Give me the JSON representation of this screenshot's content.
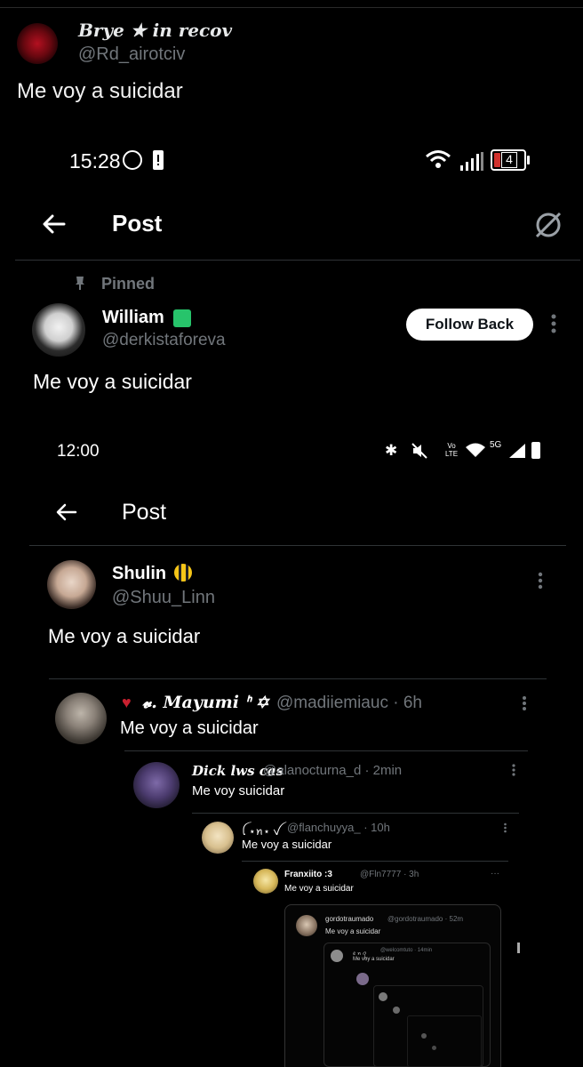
{
  "outer": {
    "author_name": "Brye ★ in recov",
    "author_handle": "@Rd_airotciv",
    "tweet_text": "Me voy a suicidar"
  },
  "screen1": {
    "status_time": "15:28",
    "battery": "4",
    "title": "Post",
    "pinned_label": "Pinned",
    "author_name": "William",
    "author_handle": "@derkistaforeva",
    "follow_label": "Follow Back",
    "tweet_text": "Me voy a suicidar"
  },
  "screen2": {
    "status_time": "12:00",
    "network": "5G",
    "volte": "Vo LTE",
    "title": "Post",
    "author_name": "Shulin",
    "author_handle": "@Shuu_Linn",
    "tweet_text": "Me voy a suicidar"
  },
  "reply1": {
    "name": "𝓿. Mayumi ᑋ ✡",
    "handle_time": "@madiiemiauc · 6h",
    "text": "Me voy a suicidar"
  },
  "reply2": {
    "name": "Dick lws cas",
    "handle_time": "@alanocturna_d · 2min",
    "text": "Me voy suicidar"
  },
  "reply3": {
    "name": "ꪶ ⋆ꪀ⋆ ꪜ",
    "handle_time": "@flanchuyya_ · 10h",
    "text": "Me voy a suicidar"
  },
  "reply4": {
    "name": "Franxiito :3",
    "handle_time": "@Fln7777 · 3h",
    "text": "Me voy a suicidar"
  },
  "reply5": {
    "name": "gordotraumado",
    "handle_time": "@gordotraumado · 52m",
    "text": "Me voy a suicidar"
  },
  "reply6": {
    "name": "ꫀ ꪀ ꪖ",
    "handle_time": "@welcomtuto · 14min",
    "text": "Me voy a suicidar"
  },
  "colors": {
    "bg": "#000000",
    "text": "#e7e9ea",
    "muted": "#71767b",
    "divider": "#2f3336"
  }
}
